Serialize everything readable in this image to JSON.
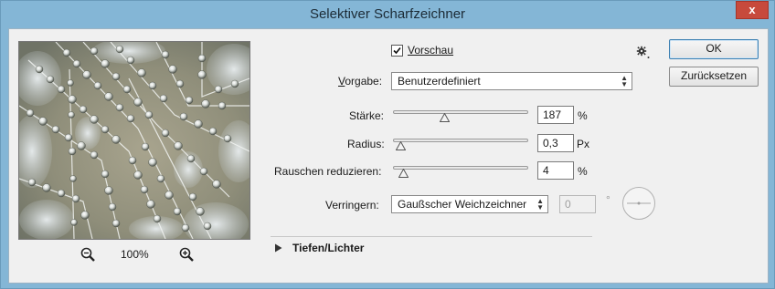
{
  "window": {
    "title": "Selektiver Scharfzeichner",
    "close_label": "x"
  },
  "preview": {
    "zoom": "100%"
  },
  "vorschau": {
    "label": "Vorschau",
    "checked": true
  },
  "buttons": {
    "ok": "OK",
    "reset": "Zurücksetzen"
  },
  "vorgabe": {
    "label": "Vorgabe:",
    "value": "Benutzerdefiniert"
  },
  "staerke": {
    "label": "Stärke:",
    "value": "187",
    "unit": "%",
    "level": 0.37
  },
  "radius": {
    "label": "Radius:",
    "value": "0,3",
    "unit": "Px",
    "level": 0.02
  },
  "rauschen": {
    "label": "Rauschen reduzieren:",
    "value": "4",
    "unit": "%",
    "level": 0.04
  },
  "verringern": {
    "label": "Verringern:",
    "value": "Gaußscher Weichzeichner",
    "angle_value": "0",
    "angle_unit": "°"
  },
  "section": {
    "label": "Tiefen/Lichter"
  },
  "icons": {
    "gear": "gear-icon",
    "zoom_out": "zoom-out-icon",
    "zoom_in": "zoom-in-icon",
    "disclosure": "triangle-right-icon"
  }
}
